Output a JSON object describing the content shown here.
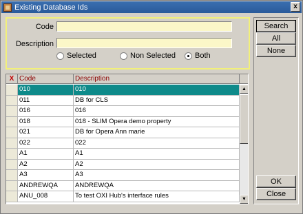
{
  "window": {
    "title": "Existing Database Ids",
    "close_label": "x"
  },
  "criteria": {
    "code_label": "Code",
    "code_value": "",
    "description_label": "Description",
    "description_value": "",
    "radios": [
      {
        "label": "Selected",
        "checked": false
      },
      {
        "label": "Non Selected",
        "checked": false
      },
      {
        "label": "Both",
        "checked": true
      }
    ]
  },
  "buttons": {
    "search": "Search",
    "all": "All",
    "none": "None",
    "ok": "OK",
    "close": "Close"
  },
  "grid": {
    "columns": {
      "x": "X",
      "code": "Code",
      "description": "Description"
    },
    "rows": [
      {
        "code": "010",
        "description": "010",
        "selected": true
      },
      {
        "code": "011",
        "description": "DB for CLS"
      },
      {
        "code": "016",
        "description": "016"
      },
      {
        "code": "018",
        "description": "018 - SLIM Opera demo property"
      },
      {
        "code": "021",
        "description": "DB for Opera Ann marie"
      },
      {
        "code": "022",
        "description": "022"
      },
      {
        "code": "A1",
        "description": "A1"
      },
      {
        "code": "A2",
        "description": "A2"
      },
      {
        "code": "A3",
        "description": "A3"
      },
      {
        "code": "ANDREWQA",
        "description": "ANDREWQA"
      },
      {
        "code": "ANU_008",
        "description": "To test OXI Hub's interface rules"
      }
    ]
  },
  "colors": {
    "selected_row": "#0e8a8a",
    "input_background": "#fbf7c8",
    "criteria_border": "#f2f07a",
    "header_text": "#8b0000"
  },
  "icons": {
    "scroll_up": "up-arrow-icon",
    "scroll_down": "down-arrow-icon",
    "title": "app-icon"
  }
}
